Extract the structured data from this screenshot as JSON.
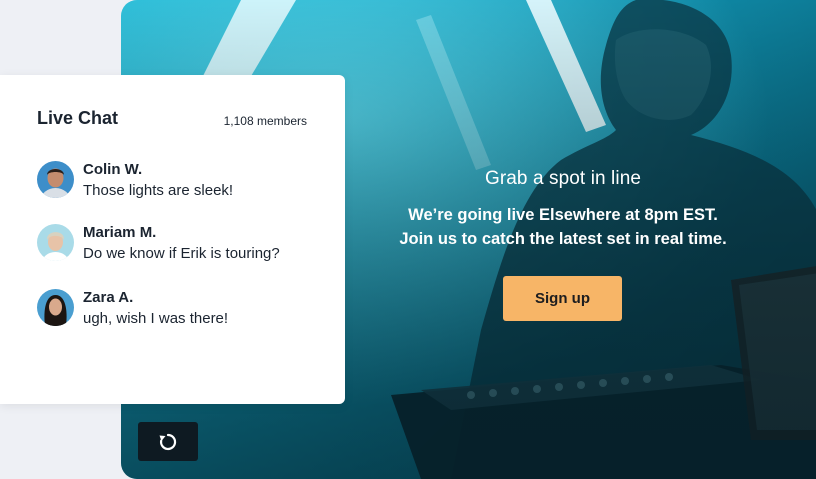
{
  "chat": {
    "title": "Live Chat",
    "members": "1,108 members",
    "messages": [
      {
        "name": "Colin W.",
        "text": "Those lights are sleek!",
        "avatar": "man-avatar"
      },
      {
        "name": "Mariam M.",
        "text": "Do we know if Erik is touring?",
        "avatar": "woman-short-hair-avatar"
      },
      {
        "name": "Zara A.",
        "text": "ugh, wish I was there!",
        "avatar": "woman-long-hair-avatar"
      }
    ]
  },
  "hero": {
    "title": "Grab a spot in line",
    "subtitle_line1": "We’re going live Elsewhere at 8pm EST.",
    "subtitle_line2": "Join us to catch the latest set in real time.",
    "signup_label": "Sign up"
  },
  "controls": {
    "replay_icon": "replay-icon"
  },
  "colors": {
    "accent": "#f7b567",
    "stage": "#1296b4",
    "replay_bg": "#0e1a22",
    "text_dark": "#1b2430"
  }
}
